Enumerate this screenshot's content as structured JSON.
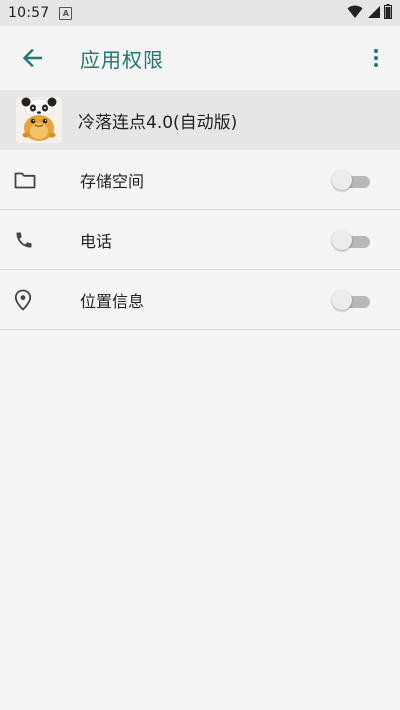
{
  "status_bar": {
    "time": "10:57",
    "notification_icon": "a-notification-icon",
    "wifi_icon": "wifi-icon",
    "signal_icon": "signal-icon",
    "battery_icon": "battery-icon"
  },
  "app_bar": {
    "back_icon": "arrow-back-icon",
    "title": "应用权限",
    "more_icon": "more-vert-icon"
  },
  "app_info": {
    "name": "冷落连点4.0(自动版)",
    "icon": "app-icon"
  },
  "permissions": [
    {
      "icon": "folder-icon",
      "label": "存储空间",
      "enabled": false
    },
    {
      "icon": "phone-icon",
      "label": "电话",
      "enabled": false
    },
    {
      "icon": "location-icon",
      "label": "位置信息",
      "enabled": false
    }
  ],
  "colors": {
    "accent": "#1d7a6e",
    "background": "#f5f5f5",
    "header_bg": "#e6e6e6",
    "divider": "#dcdcdc"
  }
}
